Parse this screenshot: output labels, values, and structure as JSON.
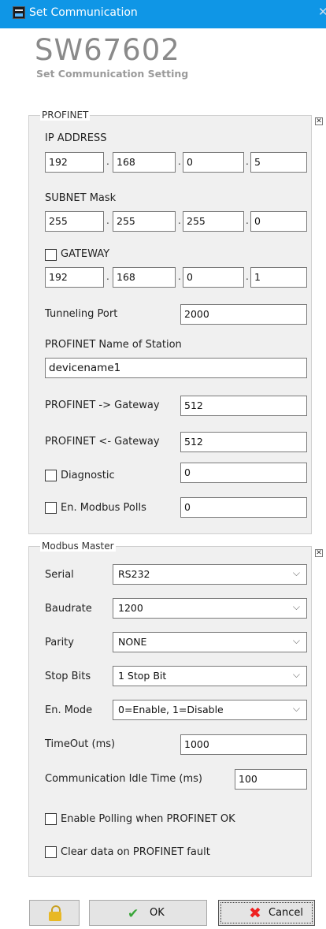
{
  "window": {
    "title": "Set Communication",
    "close_glyph": "✕"
  },
  "header": {
    "brand": "SW67602",
    "subtitle": "Set Communication Setting"
  },
  "profinet": {
    "title": "PROFINET",
    "collapse_glyph": "✕",
    "ip_label": "IP ADDRESS",
    "ip": [
      "192",
      "168",
      "0",
      "5"
    ],
    "subnet_label": "SUBNET Mask",
    "subnet": [
      "255",
      "255",
      "255",
      "0"
    ],
    "gateway_label": "GATEWAY",
    "gateway_checked": false,
    "gateway": [
      "192",
      "168",
      "0",
      "1"
    ],
    "tunneling_label": "Tunneling Port",
    "tunneling_value": "2000",
    "station_label": "PROFINET Name of Station",
    "station_value": "devicename1",
    "to_gw_label": "PROFINET -> Gateway",
    "to_gw_value": "512",
    "from_gw_label": "PROFINET <- Gateway",
    "from_gw_value": "512",
    "diag_label": "Diagnostic",
    "diag_checked": false,
    "diag_value": "0",
    "polls_label": "En. Modbus Polls",
    "polls_checked": false,
    "polls_value": "0"
  },
  "modbus": {
    "title": "Modbus Master",
    "collapse_glyph": "✕",
    "serial_label": "Serial",
    "serial_value": "RS232",
    "baud_label": "Baudrate",
    "baud_value": "1200",
    "parity_label": "Parity",
    "parity_value": "NONE",
    "stop_label": "Stop Bits",
    "stop_value": "1 Stop Bit",
    "mode_label": "En. Mode",
    "mode_value": "0=Enable, 1=Disable",
    "timeout_label": "TimeOut (ms)",
    "timeout_value": "1000",
    "idle_label": "Communication Idle Time (ms)",
    "idle_value": "100",
    "polling_label": "Enable Polling when PROFINET OK",
    "polling_checked": false,
    "clear_label": "Clear data on PROFINET fault",
    "clear_checked": false
  },
  "buttons": {
    "ok": "OK",
    "cancel": "Cancel"
  },
  "icons": {
    "app": "app-icon",
    "lock": "lock-icon",
    "ok": "check-icon",
    "cancel": "x-icon",
    "dropdown": "chevron-down-icon"
  },
  "chevron": "⌵",
  "dot": "."
}
